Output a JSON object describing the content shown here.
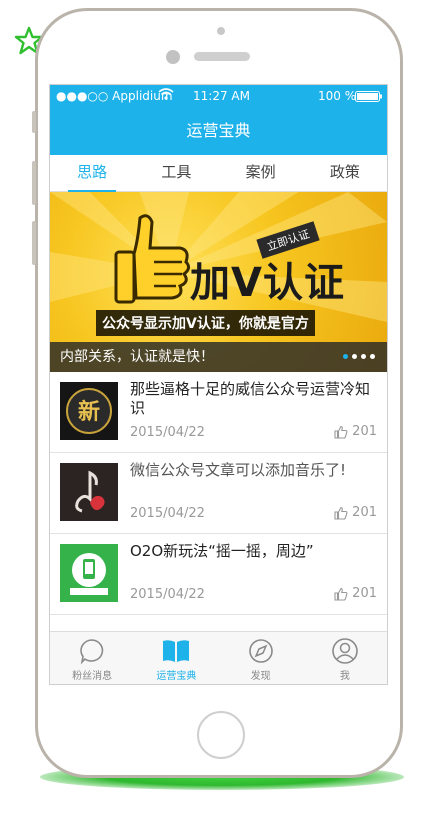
{
  "status_bar": {
    "carrier": "●●●○○ Applidium",
    "time": "11:27 AM",
    "battery": "100 %"
  },
  "nav": {
    "title": "运营宝典"
  },
  "tabs": [
    {
      "label": "思路",
      "active": true
    },
    {
      "label": "工具",
      "active": false
    },
    {
      "label": "案例",
      "active": false
    },
    {
      "label": "政策",
      "active": false
    }
  ],
  "banner": {
    "headline": "加V认证",
    "tag": "立即认证",
    "subtitle": "公众号显示加V认证，你就是官方",
    "caption": "内部关系，认证就是快！",
    "page_dots": 4,
    "active_dot": 0
  },
  "articles": [
    {
      "title": "那些逼格十足的威信公众号运营冷知识",
      "date": "2015/04/22",
      "likes": "201",
      "thumb_icon": "new-badge-thumbnail"
    },
    {
      "title": "微信公众号文章可以添加音乐了!",
      "date": "2015/04/22",
      "likes": "201",
      "thumb_icon": "music-note-thumbnail"
    },
    {
      "title": "O2O新玩法“摇一摇，周边”",
      "date": "2015/04/22",
      "likes": "201",
      "thumb_icon": "shake-phone-thumbnail"
    }
  ],
  "tabbar": [
    {
      "label": "粉丝消息",
      "icon": "chat-bubble-icon",
      "active": false
    },
    {
      "label": "运营宝典",
      "icon": "book-icon",
      "active": true
    },
    {
      "label": "发现",
      "icon": "compass-icon",
      "active": false
    },
    {
      "label": "我",
      "icon": "user-icon",
      "active": false
    }
  ],
  "colors": {
    "accent": "#1eb2ea",
    "banner_yellow": "#f7c620",
    "glow_green": "#3fd13f"
  }
}
